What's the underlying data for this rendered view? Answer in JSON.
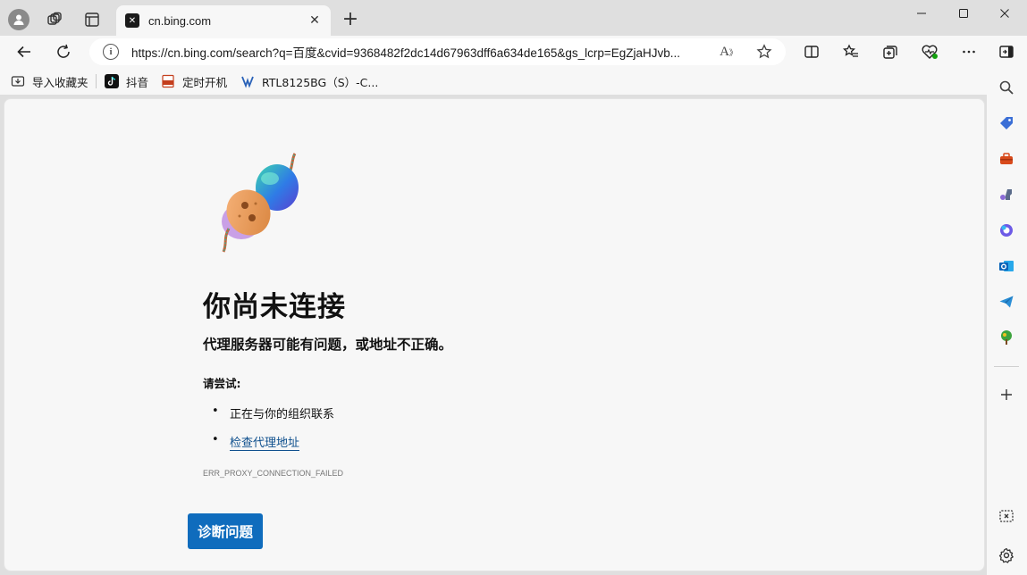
{
  "tab": {
    "title": "cn.bing.com",
    "close_glyph": "✕"
  },
  "window": {
    "minimize_glyph": "—",
    "maximize_glyph": "☐",
    "close_glyph": "✕",
    "new_tab_glyph": "+"
  },
  "address": {
    "url": "https://cn.bing.com/search?q=百度&cvid=9368482f2dc14d67963dff6a634de165&gs_lcrp=EgZjaHJvb...",
    "info_glyph": "i"
  },
  "bookmarks": [
    {
      "label": "导入收藏夹",
      "icon": "import-favorites-icon"
    },
    {
      "label": "抖音",
      "icon": "douyin-icon"
    },
    {
      "label": "定时开机",
      "icon": "pdf-icon"
    },
    {
      "label": "RTL8125BG（S）-C...",
      "icon": "realtek-icon"
    }
  ],
  "error": {
    "title": "你尚未连接",
    "subtitle": "代理服务器可能有问题，或地址不正确。",
    "try_label": "请尝试:",
    "suggestions": [
      {
        "text": "正在与你的组织联系",
        "is_link": false
      },
      {
        "text": "检查代理地址",
        "is_link": true
      }
    ],
    "code": "ERR_PROXY_CONNECTION_FAILED",
    "button_label": "诊断问题"
  },
  "colors": {
    "accent": "#0f6cbd",
    "link": "#0e4f8d",
    "chrome": "#dfdfdf",
    "surface": "#f7f7f7"
  }
}
